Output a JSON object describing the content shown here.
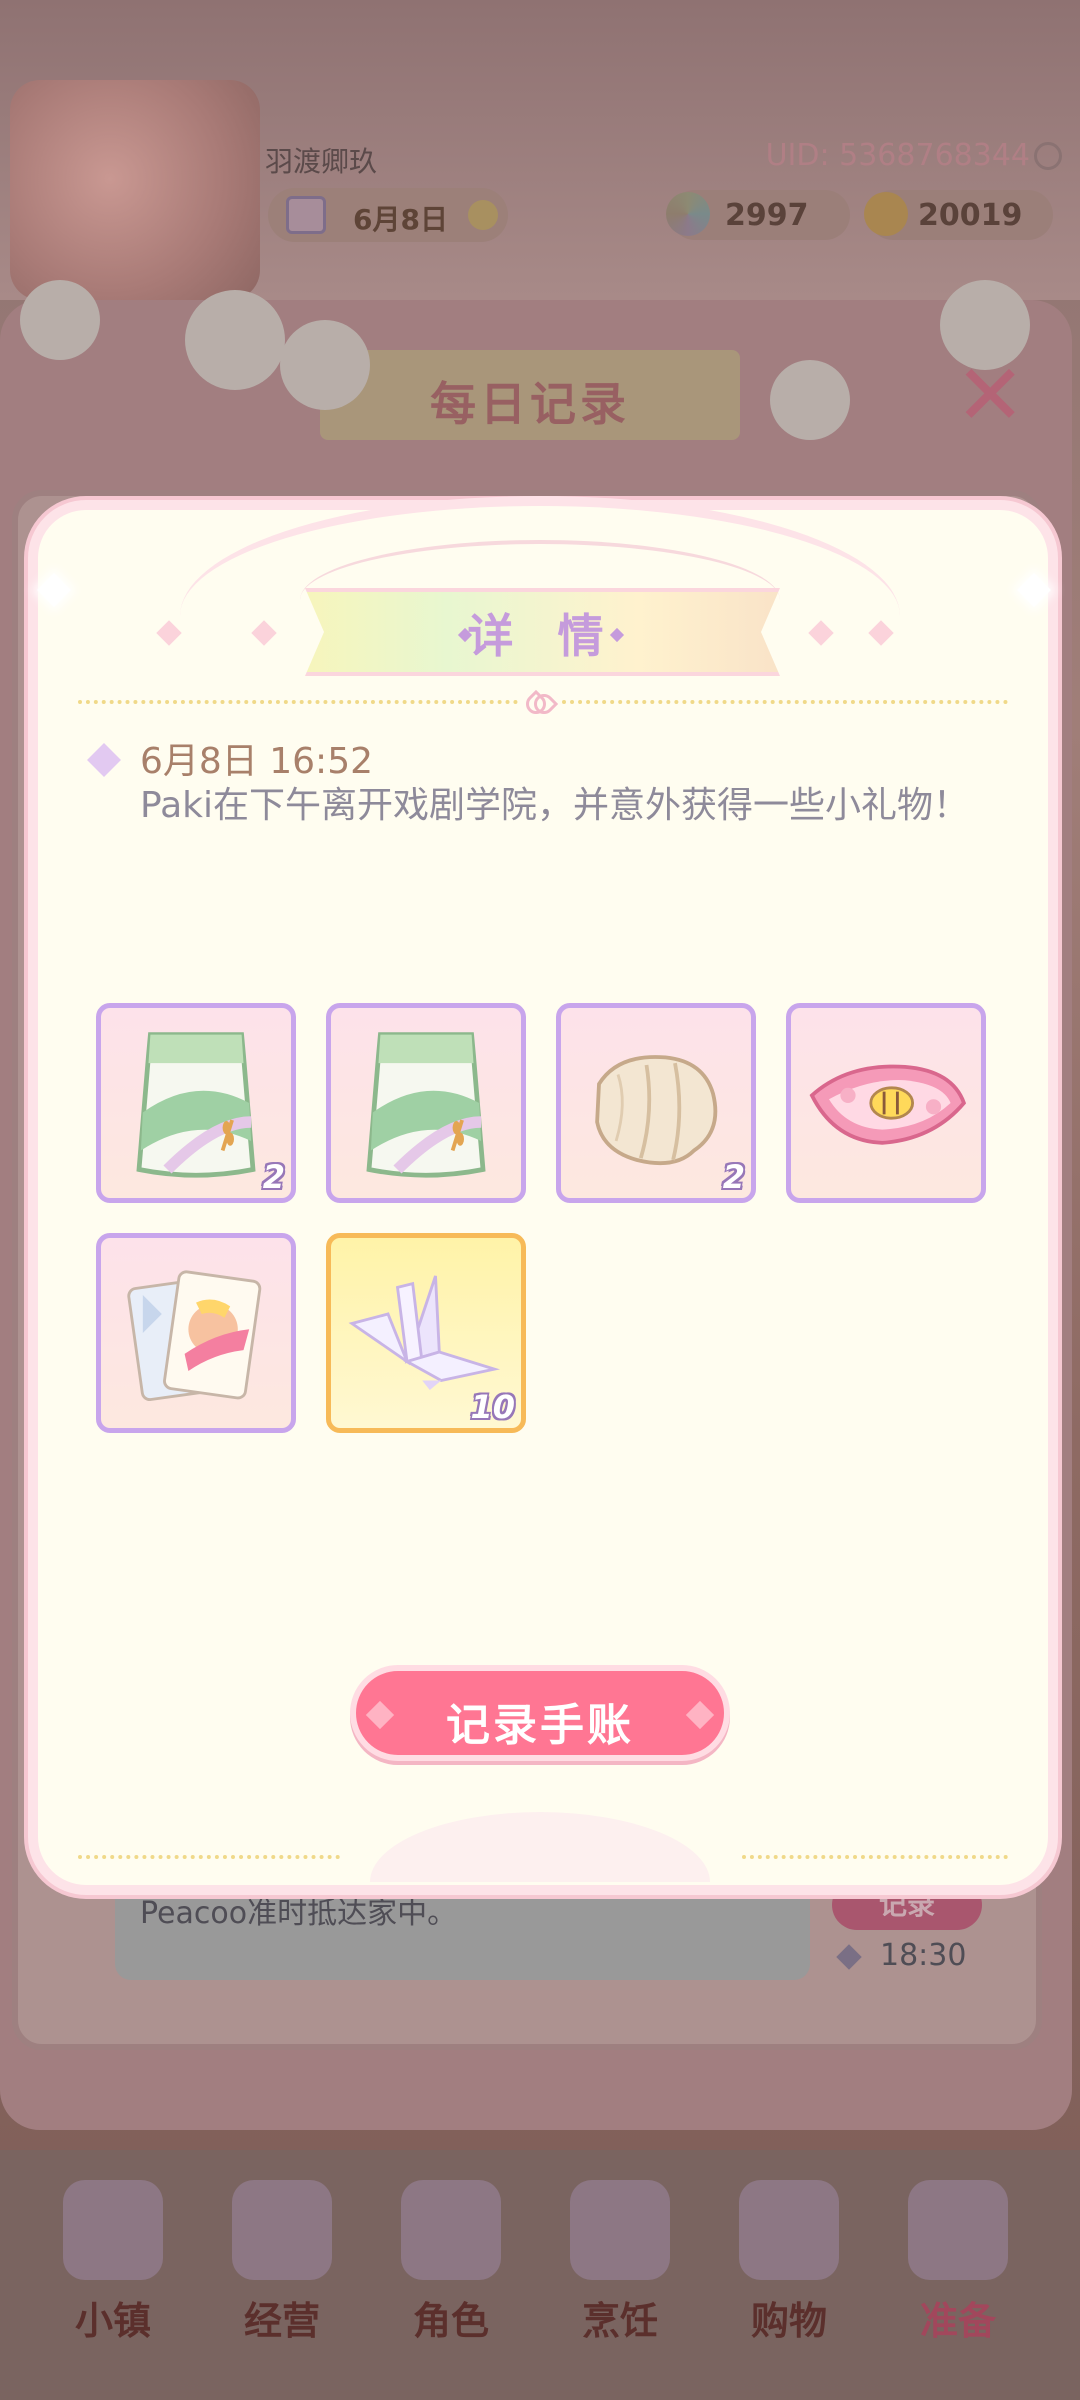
{
  "header": {
    "player_name": "羽渡卿玖",
    "uid": "UID: 5368768344",
    "date": "6月8日",
    "gems": "2997",
    "coins": "20019"
  },
  "journal": {
    "title": "每日记录",
    "close_label": "✕",
    "entry_text": "Peacoo准时抵达家中。",
    "record_label": "记录",
    "entry_time": "18:30"
  },
  "dialog": {
    "title": "详 情",
    "message_time": "6月8日 16:52",
    "message": "Paki在下午离开戏剧学院，并意外获得一些小礼物！",
    "items": [
      {
        "icon": "flour-bag-icon",
        "count": "2",
        "rarity": "normal"
      },
      {
        "icon": "flour-bag-icon",
        "count": "",
        "rarity": "normal"
      },
      {
        "icon": "cloth-bundle-icon",
        "count": "2",
        "rarity": "normal"
      },
      {
        "icon": "pink-napkin-icon",
        "count": "",
        "rarity": "normal"
      },
      {
        "icon": "playing-cards-icon",
        "count": "",
        "rarity": "normal"
      },
      {
        "icon": "paper-crane-icon",
        "count": "10",
        "rarity": "gold"
      }
    ],
    "button_label": "记录手账"
  },
  "nav": [
    {
      "label": "小镇",
      "icon": "map-icon",
      "active": false
    },
    {
      "label": "经营",
      "icon": "shop-bag-icon",
      "active": false
    },
    {
      "label": "角色",
      "icon": "character-icon",
      "active": false
    },
    {
      "label": "烹饪",
      "icon": "sandwich-icon",
      "active": false
    },
    {
      "label": "购物",
      "icon": "shopping-bag-icon",
      "active": false
    },
    {
      "label": "准备",
      "icon": "basket-icon",
      "active": true
    }
  ],
  "colors": {
    "accent_pink": "#ff7693",
    "slot_border": "#c8a5ec",
    "gold_border": "#f7ba58",
    "title_purple": "#c59bdc"
  }
}
